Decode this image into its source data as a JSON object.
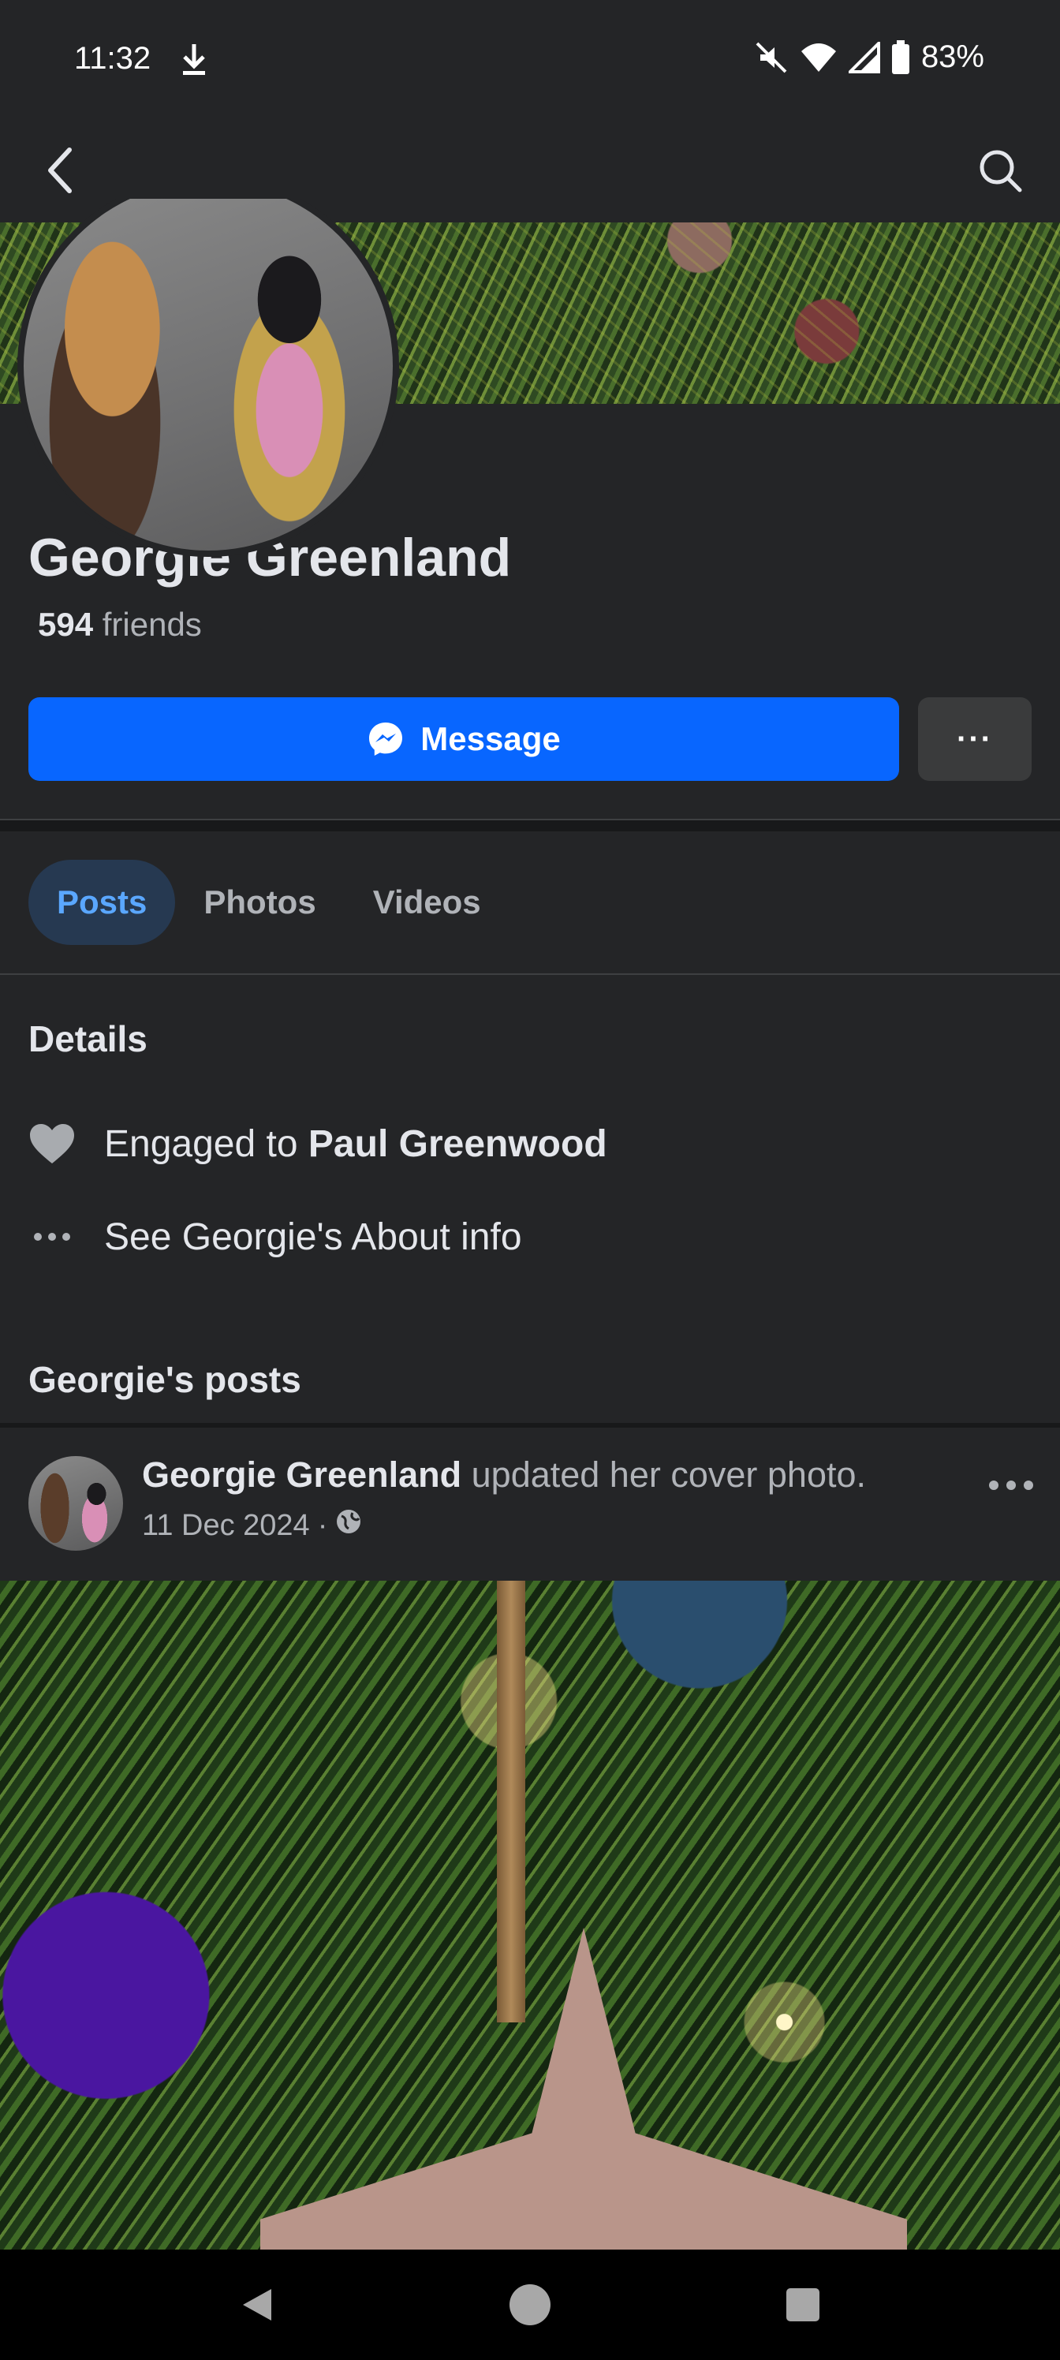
{
  "status_bar": {
    "time": "11:32",
    "battery": "83%",
    "icons": [
      "download-icon",
      "mute-icon",
      "wifi-icon",
      "signal-icon",
      "battery-icon"
    ]
  },
  "app_bar": {
    "icons": [
      "back-icon",
      "search-icon"
    ]
  },
  "profile": {
    "name": "Georgie Greenland",
    "friends_count": "594",
    "friends_label": "friends",
    "message_label": "Message",
    "more_label": "···"
  },
  "tabs": [
    {
      "label": "Posts",
      "active": true
    },
    {
      "label": "Photos",
      "active": false
    },
    {
      "label": "Videos",
      "active": false
    }
  ],
  "details": {
    "title": "Details",
    "engaged_prefix": "Engaged to",
    "engaged_name": "Paul Greenwood",
    "about_link": "See Georgie's About info"
  },
  "posts": {
    "title": "Georgie's posts",
    "items": [
      {
        "author": "Georgie Greenland",
        "action": "updated her cover photo.",
        "date": "11 Dec 2024",
        "separator": "·",
        "privacy_icon": "globe-icon"
      }
    ]
  },
  "colors": {
    "background": "#242527",
    "primary_button": "#0866ff",
    "active_tab_bg": "#263951",
    "active_tab_text": "#5aa7ff"
  }
}
